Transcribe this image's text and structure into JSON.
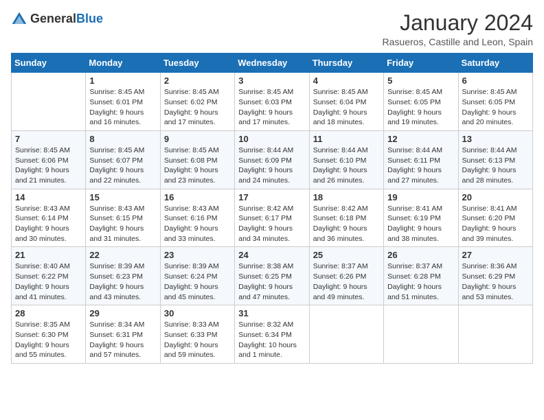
{
  "header": {
    "logo_general": "General",
    "logo_blue": "Blue",
    "title": "January 2024",
    "location": "Rasueros, Castille and Leon, Spain"
  },
  "days_of_week": [
    "Sunday",
    "Monday",
    "Tuesday",
    "Wednesday",
    "Thursday",
    "Friday",
    "Saturday"
  ],
  "weeks": [
    [
      {
        "num": "",
        "sunrise": "",
        "sunset": "",
        "daylight": ""
      },
      {
        "num": "1",
        "sunrise": "Sunrise: 8:45 AM",
        "sunset": "Sunset: 6:01 PM",
        "daylight": "Daylight: 9 hours and 16 minutes."
      },
      {
        "num": "2",
        "sunrise": "Sunrise: 8:45 AM",
        "sunset": "Sunset: 6:02 PM",
        "daylight": "Daylight: 9 hours and 17 minutes."
      },
      {
        "num": "3",
        "sunrise": "Sunrise: 8:45 AM",
        "sunset": "Sunset: 6:03 PM",
        "daylight": "Daylight: 9 hours and 17 minutes."
      },
      {
        "num": "4",
        "sunrise": "Sunrise: 8:45 AM",
        "sunset": "Sunset: 6:04 PM",
        "daylight": "Daylight: 9 hours and 18 minutes."
      },
      {
        "num": "5",
        "sunrise": "Sunrise: 8:45 AM",
        "sunset": "Sunset: 6:05 PM",
        "daylight": "Daylight: 9 hours and 19 minutes."
      },
      {
        "num": "6",
        "sunrise": "Sunrise: 8:45 AM",
        "sunset": "Sunset: 6:05 PM",
        "daylight": "Daylight: 9 hours and 20 minutes."
      }
    ],
    [
      {
        "num": "7",
        "sunrise": "Sunrise: 8:45 AM",
        "sunset": "Sunset: 6:06 PM",
        "daylight": "Daylight: 9 hours and 21 minutes."
      },
      {
        "num": "8",
        "sunrise": "Sunrise: 8:45 AM",
        "sunset": "Sunset: 6:07 PM",
        "daylight": "Daylight: 9 hours and 22 minutes."
      },
      {
        "num": "9",
        "sunrise": "Sunrise: 8:45 AM",
        "sunset": "Sunset: 6:08 PM",
        "daylight": "Daylight: 9 hours and 23 minutes."
      },
      {
        "num": "10",
        "sunrise": "Sunrise: 8:44 AM",
        "sunset": "Sunset: 6:09 PM",
        "daylight": "Daylight: 9 hours and 24 minutes."
      },
      {
        "num": "11",
        "sunrise": "Sunrise: 8:44 AM",
        "sunset": "Sunset: 6:10 PM",
        "daylight": "Daylight: 9 hours and 26 minutes."
      },
      {
        "num": "12",
        "sunrise": "Sunrise: 8:44 AM",
        "sunset": "Sunset: 6:11 PM",
        "daylight": "Daylight: 9 hours and 27 minutes."
      },
      {
        "num": "13",
        "sunrise": "Sunrise: 8:44 AM",
        "sunset": "Sunset: 6:13 PM",
        "daylight": "Daylight: 9 hours and 28 minutes."
      }
    ],
    [
      {
        "num": "14",
        "sunrise": "Sunrise: 8:43 AM",
        "sunset": "Sunset: 6:14 PM",
        "daylight": "Daylight: 9 hours and 30 minutes."
      },
      {
        "num": "15",
        "sunrise": "Sunrise: 8:43 AM",
        "sunset": "Sunset: 6:15 PM",
        "daylight": "Daylight: 9 hours and 31 minutes."
      },
      {
        "num": "16",
        "sunrise": "Sunrise: 8:43 AM",
        "sunset": "Sunset: 6:16 PM",
        "daylight": "Daylight: 9 hours and 33 minutes."
      },
      {
        "num": "17",
        "sunrise": "Sunrise: 8:42 AM",
        "sunset": "Sunset: 6:17 PM",
        "daylight": "Daylight: 9 hours and 34 minutes."
      },
      {
        "num": "18",
        "sunrise": "Sunrise: 8:42 AM",
        "sunset": "Sunset: 6:18 PM",
        "daylight": "Daylight: 9 hours and 36 minutes."
      },
      {
        "num": "19",
        "sunrise": "Sunrise: 8:41 AM",
        "sunset": "Sunset: 6:19 PM",
        "daylight": "Daylight: 9 hours and 38 minutes."
      },
      {
        "num": "20",
        "sunrise": "Sunrise: 8:41 AM",
        "sunset": "Sunset: 6:20 PM",
        "daylight": "Daylight: 9 hours and 39 minutes."
      }
    ],
    [
      {
        "num": "21",
        "sunrise": "Sunrise: 8:40 AM",
        "sunset": "Sunset: 6:22 PM",
        "daylight": "Daylight: 9 hours and 41 minutes."
      },
      {
        "num": "22",
        "sunrise": "Sunrise: 8:39 AM",
        "sunset": "Sunset: 6:23 PM",
        "daylight": "Daylight: 9 hours and 43 minutes."
      },
      {
        "num": "23",
        "sunrise": "Sunrise: 8:39 AM",
        "sunset": "Sunset: 6:24 PM",
        "daylight": "Daylight: 9 hours and 45 minutes."
      },
      {
        "num": "24",
        "sunrise": "Sunrise: 8:38 AM",
        "sunset": "Sunset: 6:25 PM",
        "daylight": "Daylight: 9 hours and 47 minutes."
      },
      {
        "num": "25",
        "sunrise": "Sunrise: 8:37 AM",
        "sunset": "Sunset: 6:26 PM",
        "daylight": "Daylight: 9 hours and 49 minutes."
      },
      {
        "num": "26",
        "sunrise": "Sunrise: 8:37 AM",
        "sunset": "Sunset: 6:28 PM",
        "daylight": "Daylight: 9 hours and 51 minutes."
      },
      {
        "num": "27",
        "sunrise": "Sunrise: 8:36 AM",
        "sunset": "Sunset: 6:29 PM",
        "daylight": "Daylight: 9 hours and 53 minutes."
      }
    ],
    [
      {
        "num": "28",
        "sunrise": "Sunrise: 8:35 AM",
        "sunset": "Sunset: 6:30 PM",
        "daylight": "Daylight: 9 hours and 55 minutes."
      },
      {
        "num": "29",
        "sunrise": "Sunrise: 8:34 AM",
        "sunset": "Sunset: 6:31 PM",
        "daylight": "Daylight: 9 hours and 57 minutes."
      },
      {
        "num": "30",
        "sunrise": "Sunrise: 8:33 AM",
        "sunset": "Sunset: 6:33 PM",
        "daylight": "Daylight: 9 hours and 59 minutes."
      },
      {
        "num": "31",
        "sunrise": "Sunrise: 8:32 AM",
        "sunset": "Sunset: 6:34 PM",
        "daylight": "Daylight: 10 hours and 1 minute."
      },
      {
        "num": "",
        "sunrise": "",
        "sunset": "",
        "daylight": ""
      },
      {
        "num": "",
        "sunrise": "",
        "sunset": "",
        "daylight": ""
      },
      {
        "num": "",
        "sunrise": "",
        "sunset": "",
        "daylight": ""
      }
    ]
  ]
}
